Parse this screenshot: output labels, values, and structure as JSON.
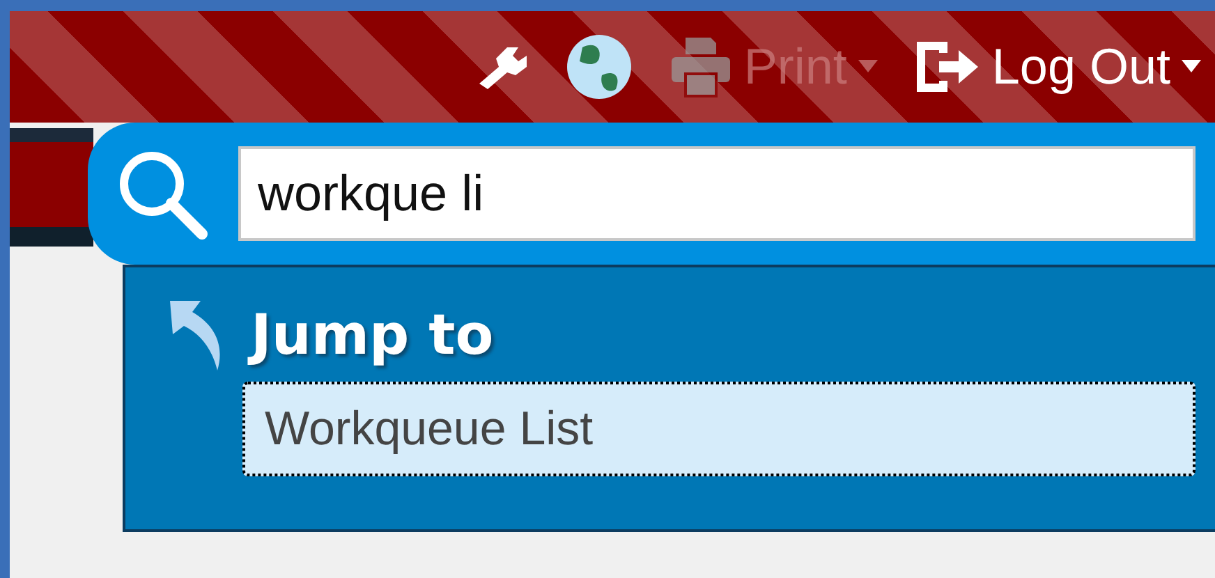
{
  "toolbar": {
    "items": [
      {
        "kind": "wrench",
        "disabled": false
      },
      {
        "kind": "globe",
        "disabled": false
      },
      {
        "kind": "print",
        "label": "Print",
        "disabled": true,
        "has_menu": true
      },
      {
        "kind": "logout",
        "label": "Log Out",
        "disabled": false,
        "has_menu": true
      }
    ]
  },
  "search": {
    "value": "workque li",
    "focused": true
  },
  "results": {
    "heading": "Jump to",
    "items": [
      {
        "label": "Workqueue List",
        "selected": true
      }
    ]
  }
}
